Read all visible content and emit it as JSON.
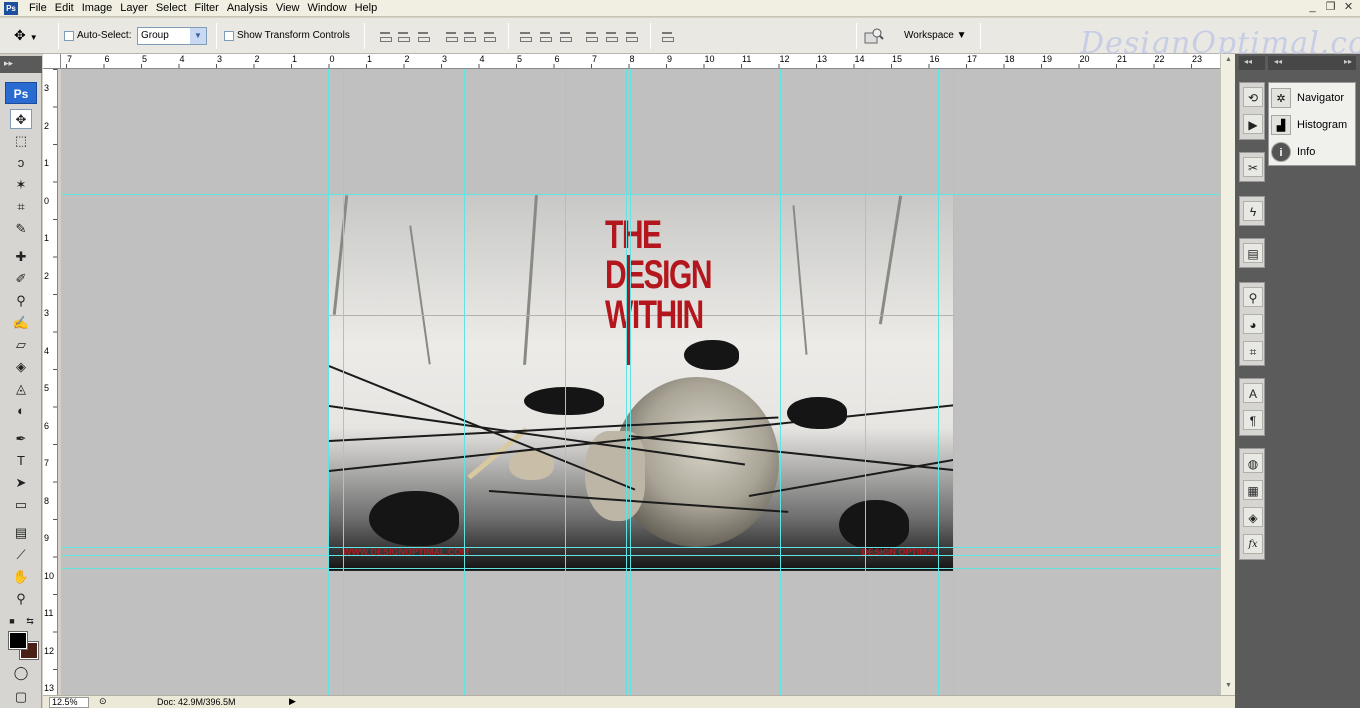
{
  "app": {
    "logo": "Ps",
    "menu_logo": "Ps"
  },
  "menu": [
    "File",
    "Edit",
    "Image",
    "Layer",
    "Select",
    "Filter",
    "Analysis",
    "View",
    "Window",
    "Help"
  ],
  "window_controls": [
    "_",
    "❐",
    "✕"
  ],
  "options": {
    "tool_icon": "move-tool",
    "auto_select_label": "Auto-Select:",
    "auto_select_value": "Group",
    "transform_label": "Show Transform Controls",
    "workspace_label": "Workspace ▼",
    "watermark": "DesignOptimal.com"
  },
  "rulers": {
    "horizontal": [
      "7",
      "6",
      "5",
      "4",
      "3",
      "2",
      "1",
      "0",
      "1",
      "2",
      "3",
      "4",
      "5",
      "6",
      "7",
      "8",
      "9",
      "10",
      "11",
      "12",
      "13",
      "14",
      "15",
      "16",
      "17",
      "18",
      "19",
      "20",
      "21",
      "22",
      "23"
    ],
    "vertical": [
      "3",
      "2",
      "1",
      "0",
      "1",
      "2",
      "3",
      "4",
      "5",
      "6",
      "7",
      "8",
      "9",
      "10",
      "11",
      "12",
      "13"
    ]
  },
  "document": {
    "title_lines": [
      "THE",
      "DESIGN",
      "WITHIN"
    ],
    "footer_left": "WWW.DESIGNOPTIMAL.COM",
    "footer_right": "DESIGN OPTIMAL"
  },
  "status": {
    "zoom": "12.5%",
    "doc": "Doc: 42.9M/396.5M"
  },
  "panels": {
    "items": [
      {
        "label": "Navigator",
        "icon": "navigator-icon"
      },
      {
        "label": "Histogram",
        "icon": "histogram-icon"
      },
      {
        "label": "Info",
        "icon": "info-icon"
      }
    ]
  },
  "colors": {
    "foreground": "#000000",
    "background": "#4a2016",
    "guides": "#5fe3e3",
    "title_red": "#b3171d"
  }
}
